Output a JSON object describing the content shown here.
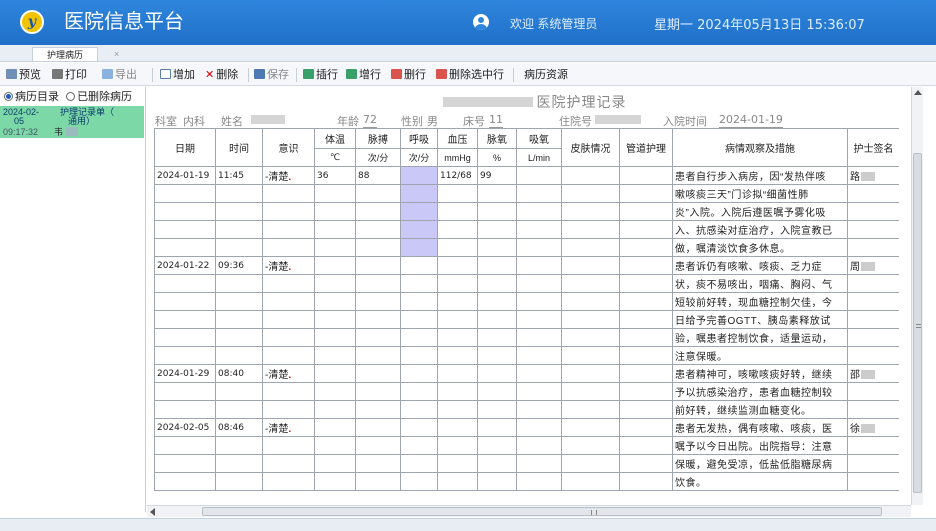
{
  "app": {
    "logo_text": "y",
    "title": "医院信息平台",
    "welcome": "欢迎 系统管理员",
    "datetime": "星期一 2024年05月13日 15:36:07",
    "tab_label": "护理病历",
    "tab_close": "×"
  },
  "toolbar": {
    "preview": "预览",
    "print": "打印",
    "export": "导出",
    "add": "增加",
    "delete": "删除",
    "save": "保存",
    "insert_row": "插行",
    "add_row": "增行",
    "delete_row": "删行",
    "delete_selected": "删除选中行",
    "history_resource": "病历资源"
  },
  "sidebar": {
    "radio_catalog": "病历目录",
    "radio_deleted": "已删除病历",
    "record": {
      "date": "2024-02-",
      "day": "05",
      "title": "护理记录单（",
      "type": "通用）",
      "time": "09:17:32",
      "name": "韦"
    }
  },
  "document": {
    "title": "医院护理记录",
    "info": {
      "dept_label": "科室",
      "dept": "内科",
      "name_label": "姓名",
      "age_label": "年龄",
      "age": "72",
      "sex_label": "性别",
      "sex": "男",
      "bed_label": "床号",
      "bed": "11",
      "admission_no_label": "住院号",
      "admit_label": "入院时间",
      "admit_date": "2024-01-19"
    },
    "headers": {
      "date": "日期",
      "time": "时间",
      "consciousness": "意识",
      "temp": "体温",
      "temp_unit": "℃",
      "pulse": "脉搏",
      "pulse_unit": "次/分",
      "resp": "呼吸",
      "resp_unit": "次/分",
      "bp": "血压",
      "bp_unit": "mmHg",
      "spo2": "脉氧",
      "spo2_unit": "%",
      "oxygen": "吸氧",
      "oxygen_unit": "L/min",
      "skin": "皮肤情况",
      "tube": "管道护理",
      "observation": "病情观察及措施",
      "nurse": "护士签名"
    },
    "entries": [
      {
        "date": "2024-01-19",
        "time": "11:45",
        "consciousness": "-清楚",
        "temp": "36",
        "pulse": "88",
        "bp": "112/68",
        "spo2": "99",
        "nurse": "路",
        "lines": [
          "患者自行步入病房，因“发热伴咳",
          "嗽咳痰三天”门诊拟“细菌性肺",
          "炎”入院。入院后遵医嘱予雾化吸",
          "入、抗感染对症治疗，入院宣教已",
          "做，嘱清淡饮食多休息。"
        ]
      },
      {
        "date": "2024-01-22",
        "time": "09:36",
        "consciousness": "-清楚",
        "temp": "",
        "pulse": "",
        "bp": "",
        "spo2": "",
        "nurse": "周",
        "lines": [
          "患者诉仍有咳嗽、咳痰、乏力症",
          "状，痰不易咳出，咽痛、胸闷、气",
          "短较前好转，现血糖控制欠佳，今",
          "日给予完善OGTT、胰岛素释放试",
          "验，嘱患者控制饮食，适量运动，",
          "注意保暖。"
        ]
      },
      {
        "date": "2024-01-29",
        "time": "08:40",
        "consciousness": "-清楚",
        "temp": "",
        "pulse": "",
        "bp": "",
        "spo2": "",
        "nurse": "邵",
        "lines": [
          "患者精神可，咳嗽咳痰好转，继续",
          "予以抗感染治疗，患者血糖控制较",
          "前好转，继续监测血糖变化。"
        ]
      },
      {
        "date": "2024-02-05",
        "time": "08:46",
        "consciousness": "-清楚",
        "temp": "",
        "pulse": "",
        "bp": "",
        "spo2": "",
        "nurse": "徐",
        "lines": [
          "患者无发热，偶有咳嗽、咳痰，医",
          "嘱予以今日出院。出院指导：注意",
          "保暖，避免受凉，低盐低脂糖尿病",
          "饮食。"
        ]
      }
    ]
  },
  "colors": {
    "titlebar": "#1f6fc8",
    "selected_record": "#7dd8a7",
    "resp_highlight": "#c9c8f7"
  }
}
